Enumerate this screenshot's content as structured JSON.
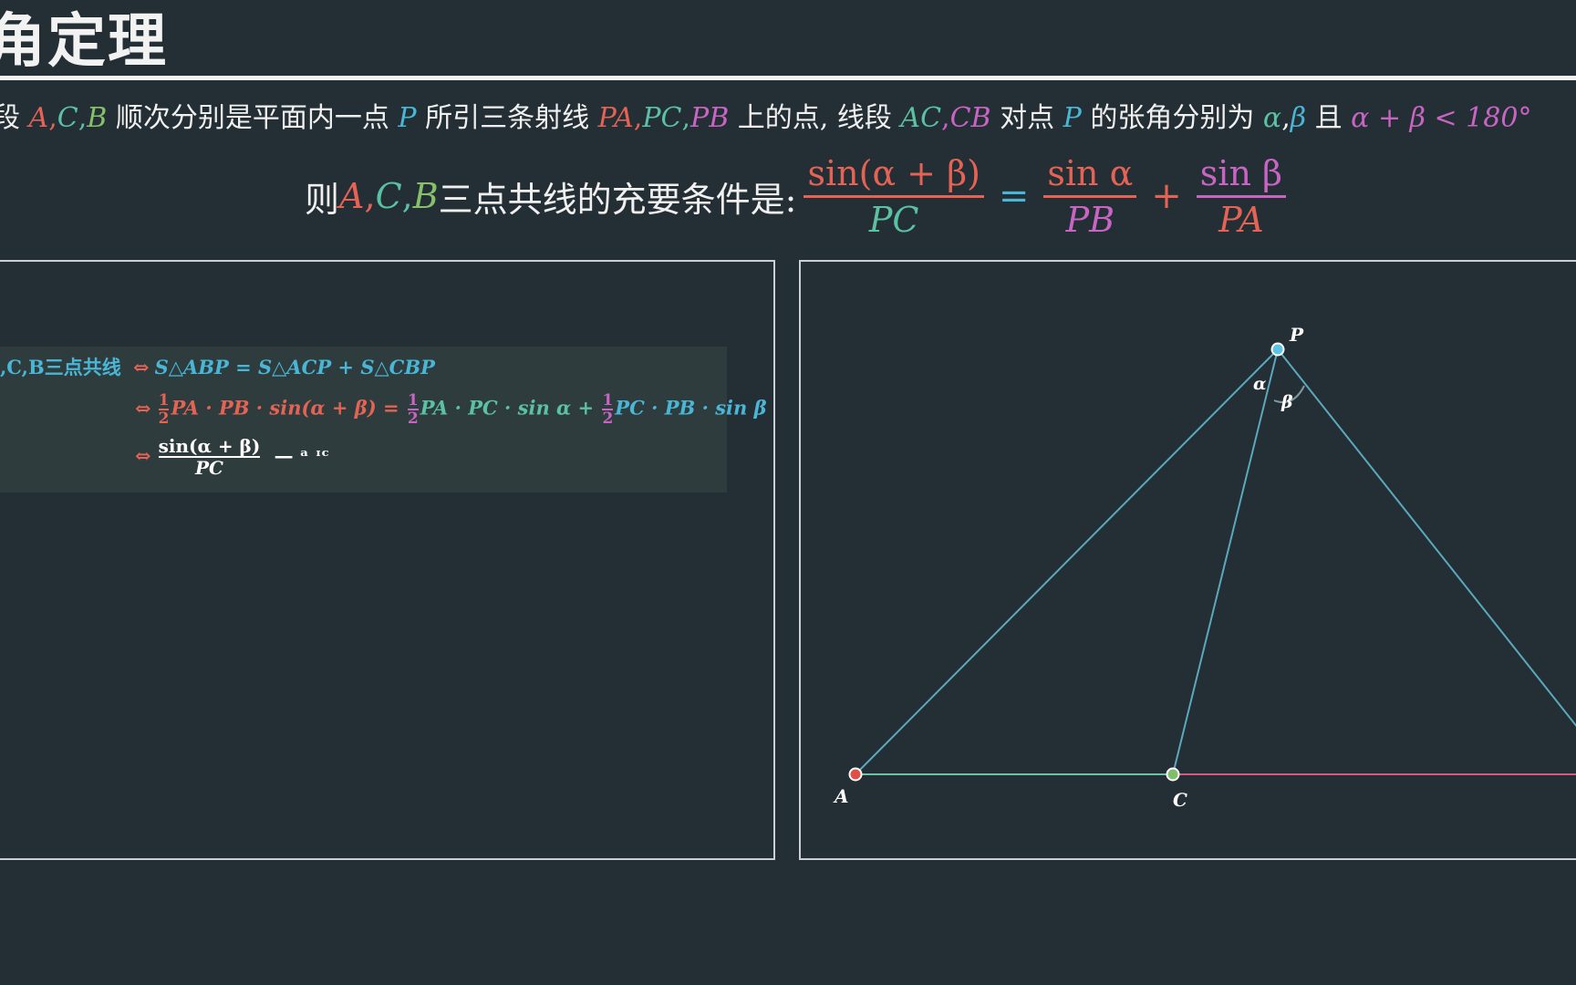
{
  "title": "角定理",
  "premise": {
    "t1": "段",
    "A": "A",
    "c1": ",",
    "C": "C",
    "c2": ",",
    "B": "B",
    "t2": " 顺次分别是平面内一点 ",
    "P": "P",
    "t3": " 所引三条射线 ",
    "PA": "PA",
    "c3": ",",
    "PC": "PC",
    "c4": ",",
    "PB": "PB",
    "t4": " 上的点, 线段 ",
    "AC": "AC",
    "c5": ",",
    "CB": "CB",
    "t5": " 对点 ",
    "P2": "P",
    "t6": " 的张角分别为 ",
    "alpha": "α",
    "c6": ",",
    "beta": "β",
    "t7": " 且 ",
    "cond": "α + β < 180°"
  },
  "conclusion": {
    "prefix": "则 ",
    "A": "A",
    "c1": ",",
    "C": "C",
    "c2": ",",
    "B": "B",
    "text": " 三点共线的充要条件是:",
    "f1_num": "sin(α + β)",
    "f1_den": "PC",
    "eq": "=",
    "f2_num": "sin α",
    "f2_den": "PB",
    "plus": "+",
    "f3_num": "sin β",
    "f3_den": "PA"
  },
  "proof": {
    "line1_left": ",C,B三点共线",
    "iff": "⇔",
    "line1_right": "S△ABP = S△ACP + S△CBP",
    "half_num": "1",
    "half_den": "2",
    "l2_a": "PA · PB · sin(α + β) =",
    "l2_b": "PA · PC · sin α +",
    "l2_c": "PC · PB · sin β",
    "l3_num": "sin(α + β)",
    "l3_den": "PC",
    "l3_tail": "— ᵃ ᶦᶜ"
  },
  "diagram": {
    "labels": {
      "P": "P",
      "A": "A",
      "C": "C",
      "alpha": "α",
      "beta": "β"
    },
    "colors": {
      "A": "#e04e45",
      "C": "#80bf6a",
      "P": "#5bc4e3",
      "AP": "#5aa9bc",
      "AC": "#6cc3a6",
      "CB": "#d45a86"
    }
  },
  "colors": {
    "background": "#242e35",
    "red": "#e46355",
    "green": "#5bc1a2",
    "light_green": "#86c06a",
    "blue": "#4ab6d6",
    "pink": "#c865c3"
  }
}
